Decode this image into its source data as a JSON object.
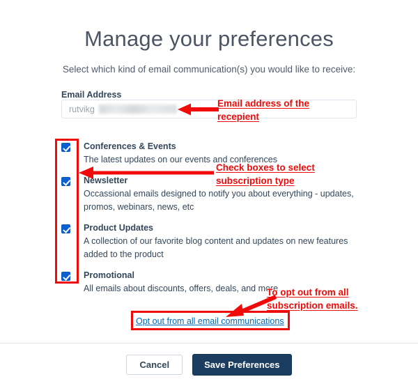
{
  "page": {
    "title": "Manage your preferences",
    "subtitle": "Select which kind of email communication(s) you would like to receive:"
  },
  "email_field": {
    "label": "Email Address",
    "value": "rutvikg",
    "placeholder": "Email Address"
  },
  "preferences": [
    {
      "title": "Conferences & Events",
      "description": "The latest updates on our events and conferences",
      "checked": true
    },
    {
      "title": "Newsletter",
      "description": "Occassional emails designed to notify you about everything - updates, promos, webinars, news, etc",
      "checked": true
    },
    {
      "title": "Product Updates",
      "description": "A collection of our favorite blog content and updates on new features added to the product",
      "checked": true
    },
    {
      "title": "Promotional",
      "description": "All emails about discounts, offers, deals, and more",
      "checked": true
    }
  ],
  "optout": {
    "label": "Opt out from all email communications"
  },
  "footer": {
    "cancel_label": "Cancel",
    "save_label": "Save Preferences"
  },
  "annotations": {
    "email": "Email address of the\nrecepient",
    "checkboxes": "Check boxes to select\nsubscription type",
    "optout": "To opt out from all\nsubscription emails."
  },
  "colors": {
    "annotation_red": "#f00a0a",
    "checkbox_blue": "#0b5fd0",
    "save_button_navy": "#1b3d5f",
    "link_blue": "#0068b3",
    "heading_gray": "#4b5563"
  }
}
